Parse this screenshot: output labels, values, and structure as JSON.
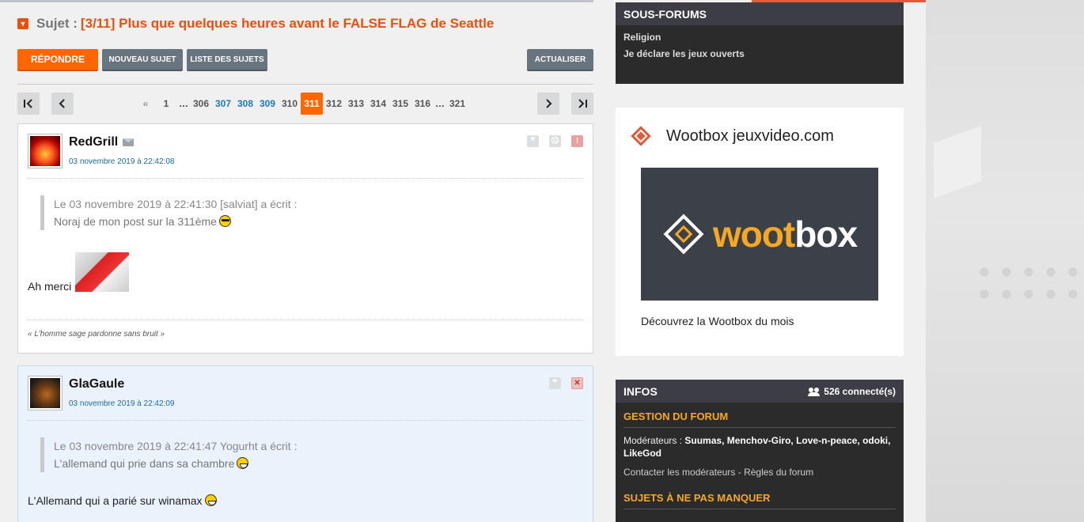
{
  "topic": {
    "prefix": "Sujet :",
    "title": "[3/11] Plus que quelques heures avant le FALSE FLAG de Seattle"
  },
  "toolbar": {
    "reply": "Répondre",
    "new_topic": "Nouveau sujet",
    "topic_list": "Liste des sujets",
    "refresh": "Actualiser"
  },
  "pagination": {
    "first": "|<",
    "prev": "<",
    "next": ">",
    "last": ">|",
    "leading": "«",
    "pages": [
      "1",
      "…",
      "306",
      "307",
      "308",
      "309",
      "310",
      "311",
      "312",
      "313",
      "314",
      "315",
      "316",
      "…",
      "321"
    ],
    "current": "311",
    "links": [
      "307",
      "308",
      "309"
    ]
  },
  "posts": [
    {
      "author": "RedGrill",
      "date": "03 novembre 2019 à 22:42:08",
      "quote_header": "Le 03 novembre 2019 à 22:41:30 [salviat] a écrit :",
      "quote_text": "Noraj de mon post sur la 311ème",
      "message": "Ah merci",
      "signature": "« L'homme sage pardonne sans bruit »",
      "icons": [
        "quote-icon",
        "sad-icon",
        "alert-icon"
      ]
    },
    {
      "author": "GlaGaule",
      "date": "03 novembre 2019 à 22:42:09",
      "quote_header": "Le 03 novembre 2019 à 22:41:47 Yogurht a écrit :",
      "quote_text": "L'allemand qui prie dans sa chambre",
      "message": "L'Allemand qui a parié sur winamax",
      "icons": [
        "quote-icon",
        "delete-icon"
      ]
    }
  ],
  "sous_forums": {
    "title": "Sous-forums",
    "items": [
      "Religion",
      "Je déclare les jeux ouverts"
    ]
  },
  "wootbox": {
    "title": "Wootbox jeuxvideo.com",
    "banner_word_1": "woot",
    "banner_word_2": "box",
    "cta": "Découvrez la Wootbox du mois"
  },
  "infos": {
    "title": "Infos",
    "connected": "526 connecté(s)",
    "gestion_title": "Gestion du forum",
    "moderators_label": "Modérateurs :",
    "moderators": "Suumas, Menchov-Giro, Love-n-peace, odoki, LikeGod",
    "contact": "Contacter les modérateurs - Règles du forum",
    "must_see_title": "Sujets à ne pas manquer"
  },
  "colors": {
    "accent": "#ff6600",
    "title_orange": "#e9500e",
    "link_blue": "#1f7ab8",
    "sidebar_dark": "#2b2b2b",
    "sidebar_gold": "#f6a821"
  }
}
